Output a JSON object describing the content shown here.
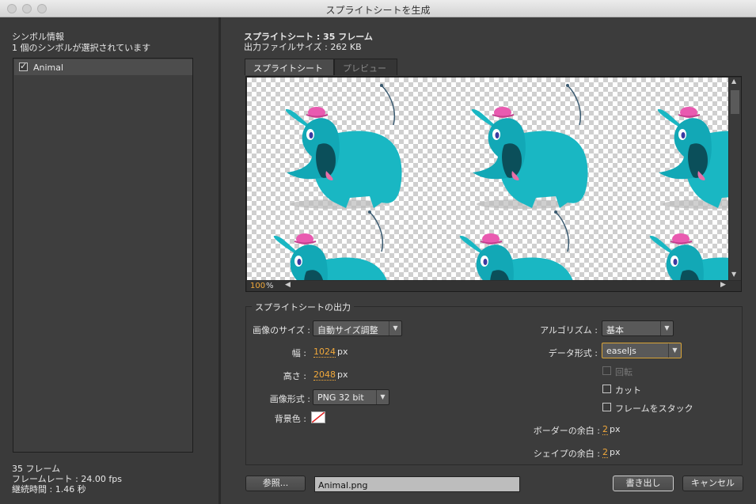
{
  "window": {
    "title": "スプライトシートを生成"
  },
  "left": {
    "heading": "シンボル情報",
    "subheading": "1 個のシンボルが選択されています",
    "symbols": [
      {
        "name": "Animal",
        "checked": true
      }
    ],
    "frames": "35 フレーム",
    "framerate": "フレームレート : 24.00 fps",
    "duration": "継続時間 : 1.46 秒"
  },
  "summary": {
    "line1": "スプライトシート : 35 フレーム",
    "line2": "出力ファイルサイズ : 262 KB"
  },
  "tabs": {
    "sheet": "スプライトシート",
    "preview": "プレビュー"
  },
  "preview": {
    "zoom": "100",
    "zoom_unit": "%"
  },
  "output": {
    "legend": "スプライトシートの出力",
    "image_size_label": "画像のサイズ :",
    "image_size_value": "自動サイズ調整",
    "width_label": "幅 :",
    "width_value": "1024",
    "height_label": "高さ :",
    "height_value": "2048",
    "unit_px": "px",
    "format_label": "画像形式 :",
    "format_value": "PNG 32 bit",
    "bg_label": "背景色 :",
    "algorithm_label": "アルゴリズム :",
    "algorithm_value": "基本",
    "data_format_label": "データ形式 :",
    "data_format_value": "easeljs",
    "rotate_label": "回転",
    "trim_label": "カット",
    "stack_label": "フレームをスタック",
    "border_label": "ボーダーの余白 :",
    "border_value": "2",
    "shape_label": "シェイプの余白 :",
    "shape_value": "2"
  },
  "footer": {
    "browse": "参照...",
    "path": "Animal.png",
    "export": "書き出し",
    "cancel": "キャンセル"
  }
}
